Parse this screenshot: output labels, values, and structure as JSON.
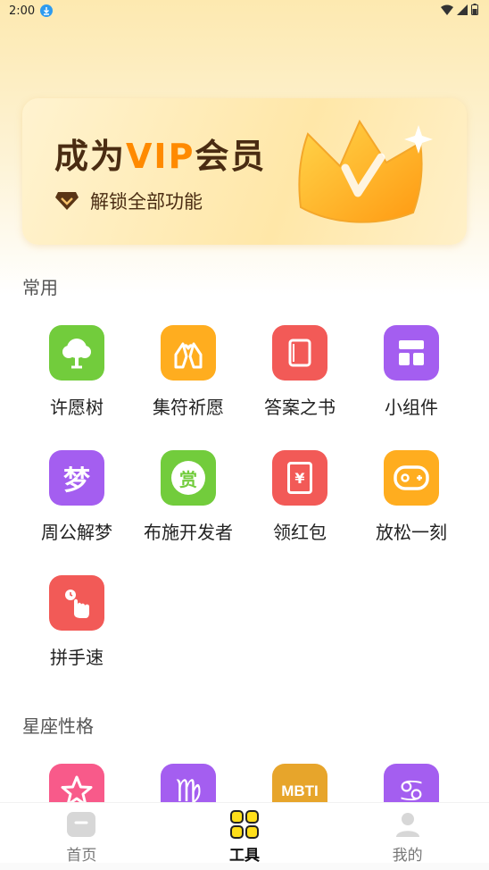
{
  "status_bar": {
    "time": "2:00"
  },
  "vip_banner": {
    "title_prefix": "成为",
    "title_vip": "VIP",
    "title_suffix": "会员",
    "subtitle": "解锁全部功能"
  },
  "sections": {
    "common_title": "常用",
    "zodiac_title": "星座性格"
  },
  "common_items": [
    {
      "label": "许愿树",
      "icon": "tree-icon",
      "color": "#72cc3c"
    },
    {
      "label": "集符祈愿",
      "icon": "praying-hands-icon",
      "color": "#ffad1f"
    },
    {
      "label": "答案之书",
      "icon": "book-icon",
      "color": "#f25a57"
    },
    {
      "label": "小组件",
      "icon": "widget-grid-icon",
      "color": "#a45ef0"
    },
    {
      "label": "周公解梦",
      "icon": "dream-icon",
      "color": "#a45ef0",
      "glyph": "梦"
    },
    {
      "label": "布施开发者",
      "icon": "reward-icon",
      "color": "#72cc3c",
      "glyph": "赏"
    },
    {
      "label": "领红包",
      "icon": "red-packet-icon",
      "color": "#f25a57",
      "glyph": "¥"
    },
    {
      "label": "放松一刻",
      "icon": "gamepad-icon",
      "color": "#ffad1f"
    },
    {
      "label": "拼手速",
      "icon": "finger-tap-icon",
      "color": "#f25a57"
    }
  ],
  "zodiac_items": [
    {
      "icon": "star-icon",
      "color": "#f85a8a"
    },
    {
      "icon": "virgo-icon",
      "color": "#a45ef0",
      "glyph": "♍"
    },
    {
      "icon": "mbti-icon",
      "color": "#e7a52b",
      "glyph": "MBTI"
    },
    {
      "icon": "cancer-icon",
      "color": "#a45ef0",
      "glyph": "♋"
    }
  ],
  "tabs": [
    {
      "label": "首页",
      "icon": "home-icon"
    },
    {
      "label": "工具",
      "icon": "tools-icon"
    },
    {
      "label": "我的",
      "icon": "profile-icon"
    }
  ]
}
